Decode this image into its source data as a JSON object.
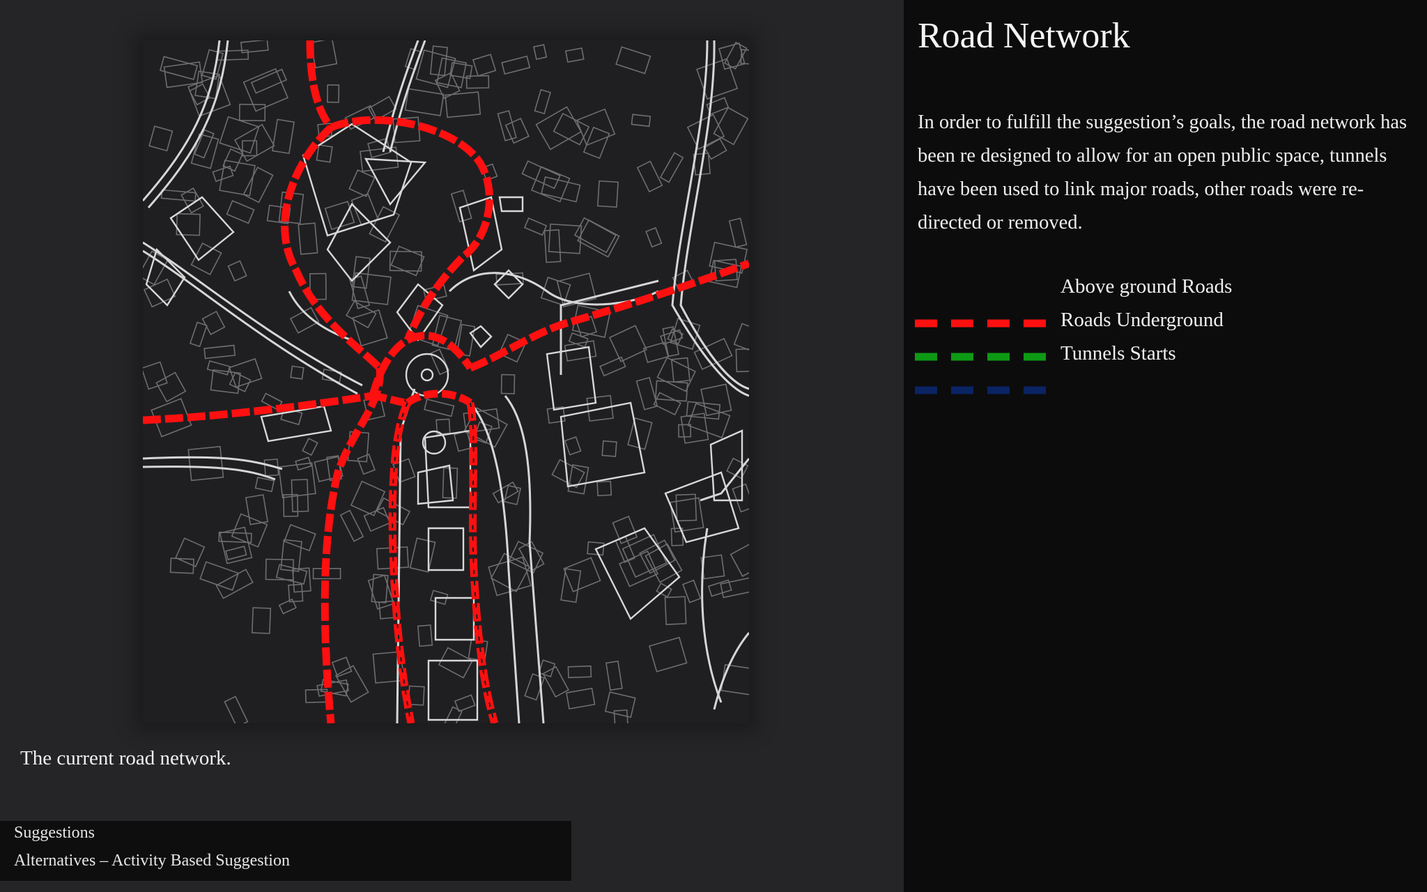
{
  "map": {
    "caption": "The current road network."
  },
  "panel": {
    "title": "Road Network",
    "body": "In order to fulfill the suggestion’s goals, the road network has been re designed to allow for an open public space, tunnels have been used to link major roads, other roads were re-directed or removed."
  },
  "legend": {
    "items": [
      {
        "label": "Above ground Roads",
        "color": "#ff1010"
      },
      {
        "label": "Roads Underground",
        "color": "#0e9a14"
      },
      {
        "label": "Tunnels Starts",
        "color": "#0a2363"
      }
    ]
  },
  "footer": {
    "section": "Suggestions",
    "subsection": "Alternatives – Activity Based Suggestion"
  },
  "colors": {
    "page_background": "#252527",
    "panel_background": "#0c0c0d",
    "road_red": "#ff1010",
    "road_outline": "#cfcfcf",
    "building_outline": "#6e6e70"
  }
}
